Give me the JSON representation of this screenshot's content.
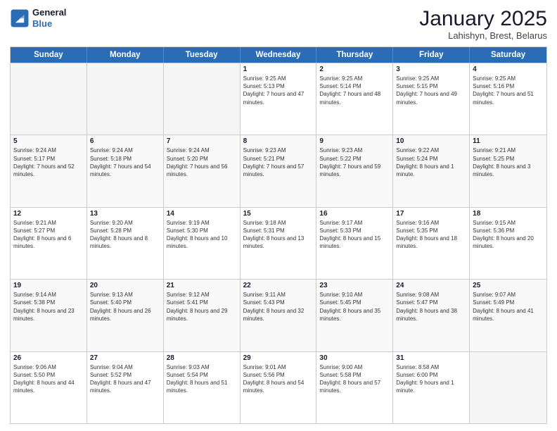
{
  "logo": {
    "line1": "General",
    "line2": "Blue"
  },
  "title": "January 2025",
  "location": "Lahishyn, Brest, Belarus",
  "days_of_week": [
    "Sunday",
    "Monday",
    "Tuesday",
    "Wednesday",
    "Thursday",
    "Friday",
    "Saturday"
  ],
  "rows": [
    [
      {
        "day": "",
        "sunrise": "",
        "sunset": "",
        "daylight": "",
        "empty": true
      },
      {
        "day": "",
        "sunrise": "",
        "sunset": "",
        "daylight": "",
        "empty": true
      },
      {
        "day": "",
        "sunrise": "",
        "sunset": "",
        "daylight": "",
        "empty": true
      },
      {
        "day": "1",
        "sunrise": "Sunrise: 9:25 AM",
        "sunset": "Sunset: 5:13 PM",
        "daylight": "Daylight: 7 hours and 47 minutes."
      },
      {
        "day": "2",
        "sunrise": "Sunrise: 9:25 AM",
        "sunset": "Sunset: 5:14 PM",
        "daylight": "Daylight: 7 hours and 48 minutes."
      },
      {
        "day": "3",
        "sunrise": "Sunrise: 9:25 AM",
        "sunset": "Sunset: 5:15 PM",
        "daylight": "Daylight: 7 hours and 49 minutes."
      },
      {
        "day": "4",
        "sunrise": "Sunrise: 9:25 AM",
        "sunset": "Sunset: 5:16 PM",
        "daylight": "Daylight: 7 hours and 51 minutes."
      }
    ],
    [
      {
        "day": "5",
        "sunrise": "Sunrise: 9:24 AM",
        "sunset": "Sunset: 5:17 PM",
        "daylight": "Daylight: 7 hours and 52 minutes."
      },
      {
        "day": "6",
        "sunrise": "Sunrise: 9:24 AM",
        "sunset": "Sunset: 5:18 PM",
        "daylight": "Daylight: 7 hours and 54 minutes."
      },
      {
        "day": "7",
        "sunrise": "Sunrise: 9:24 AM",
        "sunset": "Sunset: 5:20 PM",
        "daylight": "Daylight: 7 hours and 56 minutes."
      },
      {
        "day": "8",
        "sunrise": "Sunrise: 9:23 AM",
        "sunset": "Sunset: 5:21 PM",
        "daylight": "Daylight: 7 hours and 57 minutes."
      },
      {
        "day": "9",
        "sunrise": "Sunrise: 9:23 AM",
        "sunset": "Sunset: 5:22 PM",
        "daylight": "Daylight: 7 hours and 59 minutes."
      },
      {
        "day": "10",
        "sunrise": "Sunrise: 9:22 AM",
        "sunset": "Sunset: 5:24 PM",
        "daylight": "Daylight: 8 hours and 1 minute."
      },
      {
        "day": "11",
        "sunrise": "Sunrise: 9:21 AM",
        "sunset": "Sunset: 5:25 PM",
        "daylight": "Daylight: 8 hours and 3 minutes."
      }
    ],
    [
      {
        "day": "12",
        "sunrise": "Sunrise: 9:21 AM",
        "sunset": "Sunset: 5:27 PM",
        "daylight": "Daylight: 8 hours and 6 minutes."
      },
      {
        "day": "13",
        "sunrise": "Sunrise: 9:20 AM",
        "sunset": "Sunset: 5:28 PM",
        "daylight": "Daylight: 8 hours and 8 minutes."
      },
      {
        "day": "14",
        "sunrise": "Sunrise: 9:19 AM",
        "sunset": "Sunset: 5:30 PM",
        "daylight": "Daylight: 8 hours and 10 minutes."
      },
      {
        "day": "15",
        "sunrise": "Sunrise: 9:18 AM",
        "sunset": "Sunset: 5:31 PM",
        "daylight": "Daylight: 8 hours and 13 minutes."
      },
      {
        "day": "16",
        "sunrise": "Sunrise: 9:17 AM",
        "sunset": "Sunset: 5:33 PM",
        "daylight": "Daylight: 8 hours and 15 minutes."
      },
      {
        "day": "17",
        "sunrise": "Sunrise: 9:16 AM",
        "sunset": "Sunset: 5:35 PM",
        "daylight": "Daylight: 8 hours and 18 minutes."
      },
      {
        "day": "18",
        "sunrise": "Sunrise: 9:15 AM",
        "sunset": "Sunset: 5:36 PM",
        "daylight": "Daylight: 8 hours and 20 minutes."
      }
    ],
    [
      {
        "day": "19",
        "sunrise": "Sunrise: 9:14 AM",
        "sunset": "Sunset: 5:38 PM",
        "daylight": "Daylight: 8 hours and 23 minutes."
      },
      {
        "day": "20",
        "sunrise": "Sunrise: 9:13 AM",
        "sunset": "Sunset: 5:40 PM",
        "daylight": "Daylight: 8 hours and 26 minutes."
      },
      {
        "day": "21",
        "sunrise": "Sunrise: 9:12 AM",
        "sunset": "Sunset: 5:41 PM",
        "daylight": "Daylight: 8 hours and 29 minutes."
      },
      {
        "day": "22",
        "sunrise": "Sunrise: 9:11 AM",
        "sunset": "Sunset: 5:43 PM",
        "daylight": "Daylight: 8 hours and 32 minutes."
      },
      {
        "day": "23",
        "sunrise": "Sunrise: 9:10 AM",
        "sunset": "Sunset: 5:45 PM",
        "daylight": "Daylight: 8 hours and 35 minutes."
      },
      {
        "day": "24",
        "sunrise": "Sunrise: 9:08 AM",
        "sunset": "Sunset: 5:47 PM",
        "daylight": "Daylight: 8 hours and 38 minutes."
      },
      {
        "day": "25",
        "sunrise": "Sunrise: 9:07 AM",
        "sunset": "Sunset: 5:49 PM",
        "daylight": "Daylight: 8 hours and 41 minutes."
      }
    ],
    [
      {
        "day": "26",
        "sunrise": "Sunrise: 9:06 AM",
        "sunset": "Sunset: 5:50 PM",
        "daylight": "Daylight: 8 hours and 44 minutes."
      },
      {
        "day": "27",
        "sunrise": "Sunrise: 9:04 AM",
        "sunset": "Sunset: 5:52 PM",
        "daylight": "Daylight: 8 hours and 47 minutes."
      },
      {
        "day": "28",
        "sunrise": "Sunrise: 9:03 AM",
        "sunset": "Sunset: 5:54 PM",
        "daylight": "Daylight: 8 hours and 51 minutes."
      },
      {
        "day": "29",
        "sunrise": "Sunrise: 9:01 AM",
        "sunset": "Sunset: 5:56 PM",
        "daylight": "Daylight: 8 hours and 54 minutes."
      },
      {
        "day": "30",
        "sunrise": "Sunrise: 9:00 AM",
        "sunset": "Sunset: 5:58 PM",
        "daylight": "Daylight: 8 hours and 57 minutes."
      },
      {
        "day": "31",
        "sunrise": "Sunrise: 8:58 AM",
        "sunset": "Sunset: 6:00 PM",
        "daylight": "Daylight: 9 hours and 1 minute."
      },
      {
        "day": "",
        "sunrise": "",
        "sunset": "",
        "daylight": "",
        "empty": true
      }
    ]
  ]
}
